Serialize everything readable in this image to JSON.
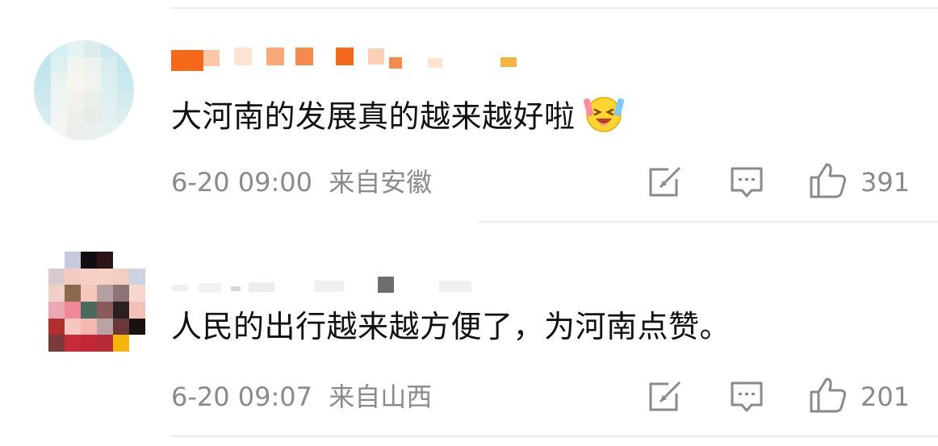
{
  "comments": [
    {
      "content": "大河南的发展真的越来越好啦",
      "emoji": "laughing-tears-emoji",
      "timestamp": "6-20 09:00",
      "location": "来自安徽",
      "like_count": "391"
    },
    {
      "content": "人民的出行越来越方便了，为河南点赞。",
      "timestamp": "6-20 09:07",
      "location": "来自山西",
      "like_count": "201"
    }
  ],
  "icons": {
    "repost": "repost-icon",
    "comment": "comment-icon",
    "like": "thumbs-up-icon"
  },
  "colors": {
    "text": "#111111",
    "meta": "#8a8a8a",
    "divider": "#ececec"
  }
}
